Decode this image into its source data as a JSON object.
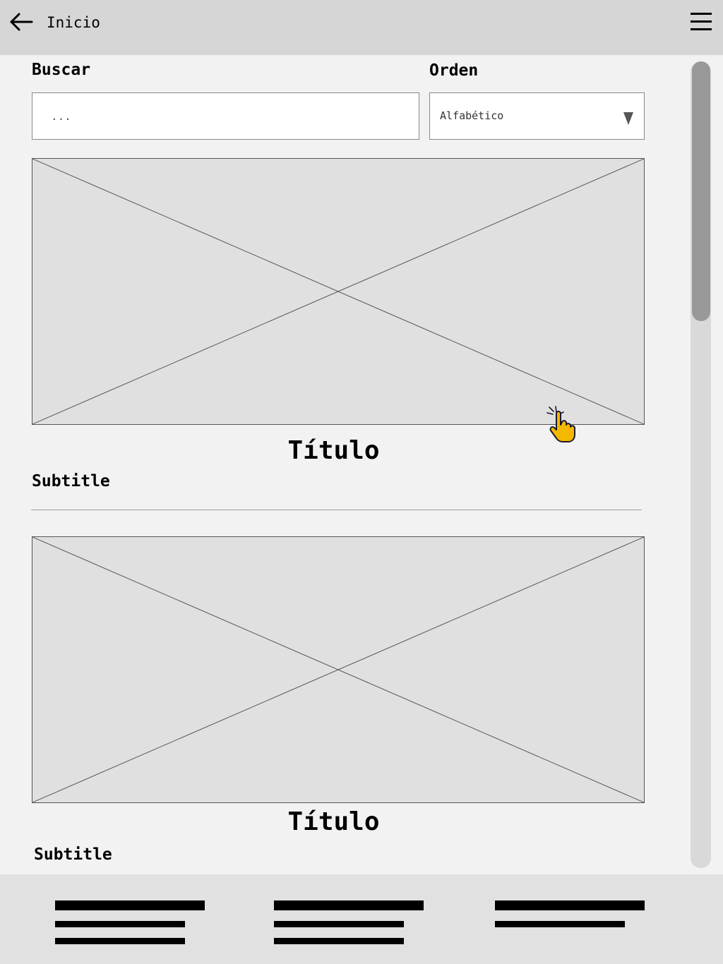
{
  "header": {
    "back_label": "Inicio",
    "back_icon": "arrow-left-icon",
    "menu_icon": "hamburger-menu-icon"
  },
  "filters": {
    "search_label": "Buscar",
    "search_placeholder": "...",
    "order_label": "Orden",
    "order_value": "Alfabético",
    "order_icon": "triangle-down-icon"
  },
  "cards": [
    {
      "image": "image-placeholder",
      "title": "Título",
      "subtitle": "Subtitle"
    },
    {
      "image": "image-placeholder",
      "title": "Título",
      "subtitle": "Subtitle"
    }
  ],
  "cursor_icon": "pointer-hand-icon",
  "footer": {
    "links": [
      "footer-link-1",
      "footer-link-2",
      "footer-link-3"
    ]
  },
  "colors": {
    "header_bg": "#d6d6d6",
    "page_bg": "#f2f2f2",
    "footer_bg": "#e1e1e1",
    "placeholder_bg": "#e0e0e0",
    "cursor": "#f5b800"
  }
}
